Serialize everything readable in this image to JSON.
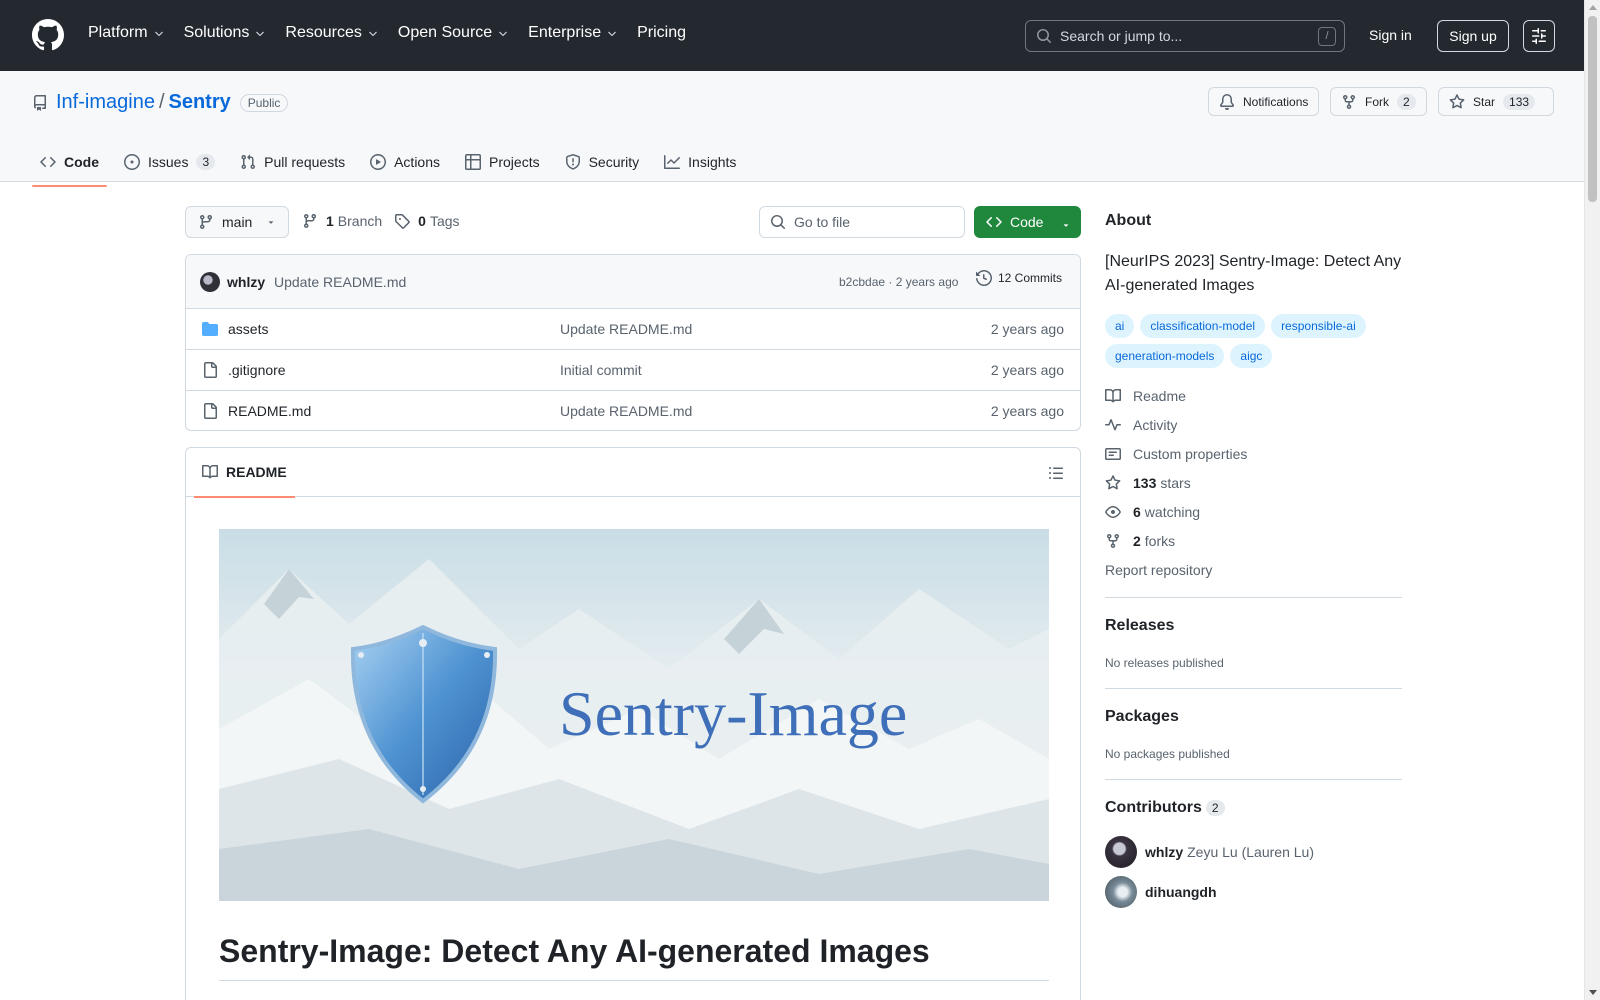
{
  "header": {
    "nav": [
      {
        "label": "Platform",
        "has_menu": true
      },
      {
        "label": "Solutions",
        "has_menu": true
      },
      {
        "label": "Resources",
        "has_menu": true
      },
      {
        "label": "Open Source",
        "has_menu": true
      },
      {
        "label": "Enterprise",
        "has_menu": true
      },
      {
        "label": "Pricing",
        "has_menu": false
      }
    ],
    "search_placeholder": "Search or jump to...",
    "search_shortcut": "/",
    "sign_in": "Sign in",
    "sign_up": "Sign up"
  },
  "repo": {
    "owner": "Inf-imagine",
    "separator": "/",
    "name": "Sentry",
    "visibility": "Public",
    "notifications_label": "Notifications",
    "fork_label": "Fork",
    "fork_count": "2",
    "star_label": "Star",
    "star_count": "133",
    "tabs": [
      {
        "label": "Code",
        "icon": "code-icon",
        "active": true,
        "count": ""
      },
      {
        "label": "Issues",
        "icon": "issue-opened-icon",
        "active": false,
        "count": "3"
      },
      {
        "label": "Pull requests",
        "icon": "git-pull-request-icon",
        "active": false,
        "count": ""
      },
      {
        "label": "Actions",
        "icon": "play-icon",
        "active": false,
        "count": ""
      },
      {
        "label": "Projects",
        "icon": "table-icon",
        "active": false,
        "count": ""
      },
      {
        "label": "Security",
        "icon": "shield-icon",
        "active": false,
        "count": ""
      },
      {
        "label": "Insights",
        "icon": "graph-icon",
        "active": false,
        "count": ""
      }
    ]
  },
  "code": {
    "branch": "main",
    "branch_count": "1",
    "branch_label": "Branch",
    "tag_count": "0",
    "tag_label": "Tags",
    "goto_placeholder": "Go to file",
    "code_button": "Code",
    "latest_commit": {
      "user": "whlzy",
      "message": "Update README.md",
      "meta": "b2cbdae · 2 years ago",
      "commits": "12 Commits"
    },
    "files": [
      {
        "type": "folder",
        "name": "assets",
        "message": "Update README.md",
        "age": "2 years ago"
      },
      {
        "type": "file",
        "name": ".gitignore",
        "message": "Initial commit",
        "age": "2 years ago"
      },
      {
        "type": "file",
        "name": "README.md",
        "message": "Update README.md",
        "age": "2 years ago"
      }
    ]
  },
  "readme": {
    "tab_label": "README",
    "banner_text": "Sentry-Image",
    "heading": "Sentry-Image: Detect Any AI-generated Images"
  },
  "sidebar": {
    "about_heading": "About",
    "description": "[NeurIPS 2023] Sentry-Image: Detect Any AI-generated Images",
    "topics": [
      "ai",
      "classification-model",
      "responsible-ai",
      "generation-models",
      "aigc"
    ],
    "links": {
      "readme": "Readme",
      "activity": "Activity",
      "custom_properties": "Custom properties",
      "stars_count": "133",
      "stars_label": "stars",
      "watching_count": "6",
      "watching_label": "watching",
      "forks_count": "2",
      "forks_label": "forks",
      "report": "Report repository"
    },
    "releases_heading": "Releases",
    "releases_text": "No releases published",
    "packages_heading": "Packages",
    "packages_text": "No packages published",
    "contributors_heading": "Contributors",
    "contributors_count": "2",
    "contributors": [
      {
        "login": "whlzy",
        "full_name": "Zeyu Lu (Lauren Lu)"
      },
      {
        "login": "dihuangdh",
        "full_name": ""
      }
    ]
  },
  "colors": {
    "header_bg": "#24292f",
    "link": "#0969da",
    "primary_button": "#1f883d",
    "active_tab_underline": "#fd8c73",
    "topic_bg": "#ddf4ff"
  }
}
